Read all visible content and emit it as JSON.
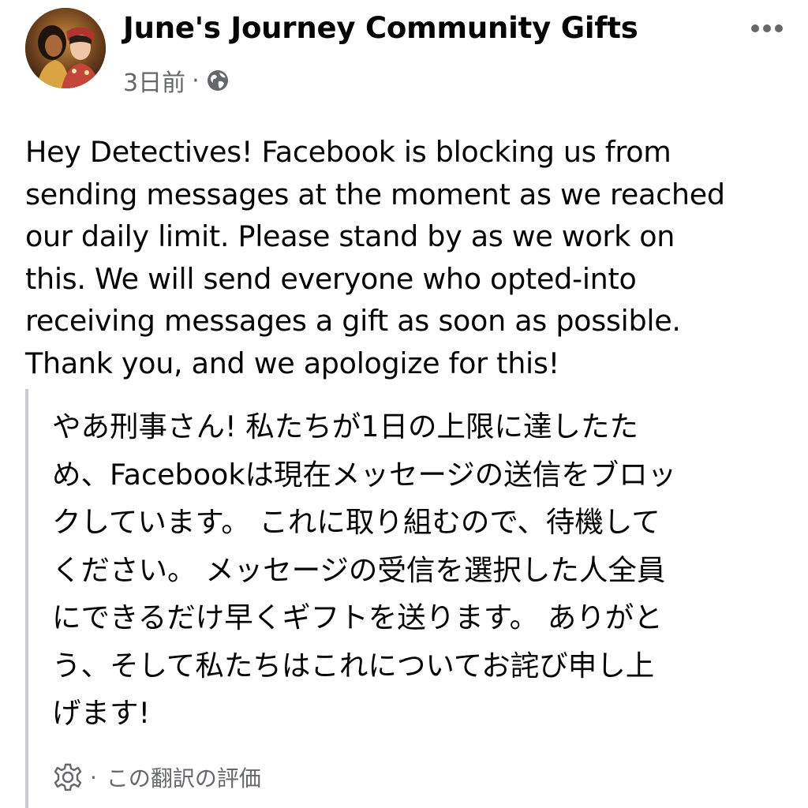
{
  "header": {
    "page_name": "June's Journey Community Gifts",
    "timestamp": "3日前",
    "separator": "·",
    "privacy_icon": "globe-icon",
    "more_icon": "more-dots-icon",
    "avatar_icon": "page-avatar"
  },
  "post": {
    "text": "Hey Detectives! Facebook is blocking us from\nsending messages at the moment as we reached\nour daily limit. Please stand by as we work on\nthis. We will send everyone who opted-into\nreceiving messages a gift as soon as possible.\nThank you, and we apologize for this!"
  },
  "translation": {
    "text": "やあ刑事さん! 私たちが1日の上限に達したた\nめ、Facebookは現在メッセージの送信をブロッ\nクしています。 これに取り組むので、待機して\nください。 メッセージの受信を選択した人全員\nにできるだけ早くギフトを送ります。 ありがと\nう、そして私たちはこれについてお詫び申し上\nげます!",
    "rate_icon": "gear-icon",
    "rate_separator": "·",
    "rate_label": "この翻訳の評価"
  },
  "colors": {
    "text": "#050505",
    "secondary_text": "#65676b",
    "quote_bar": "#c9ccd1"
  }
}
